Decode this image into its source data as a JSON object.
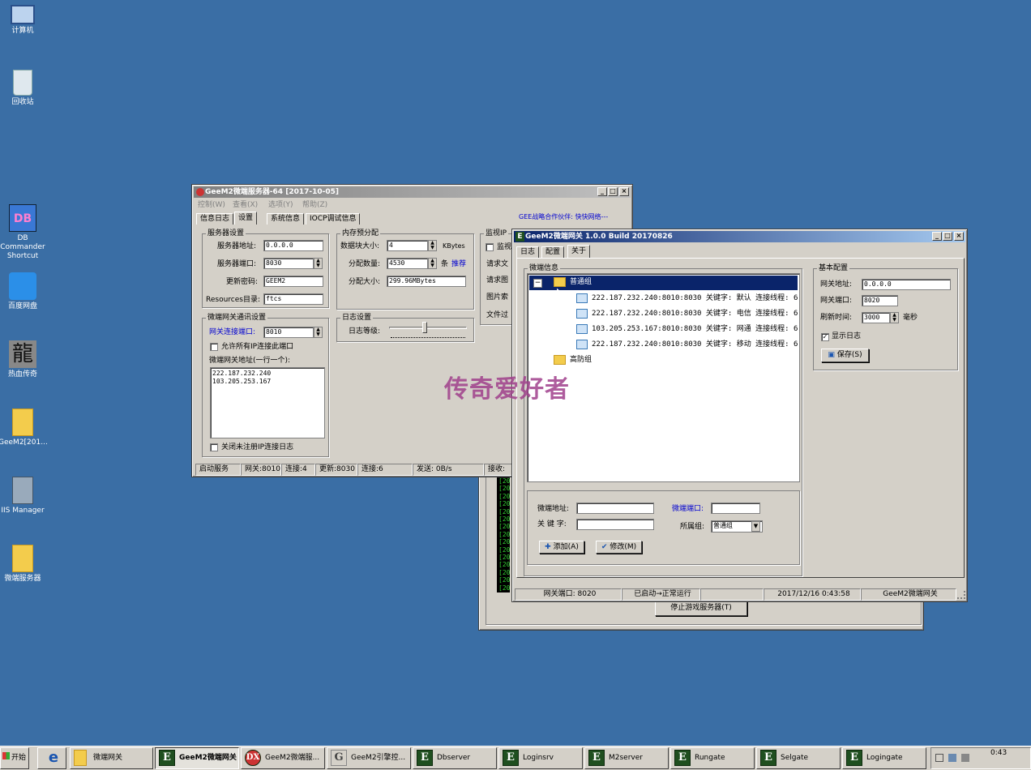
{
  "desktop": {
    "icons": [
      {
        "label": "计算机"
      },
      {
        "label": "回收站"
      },
      {
        "label": "DB Commander Shortcut",
        "img_text": "DB"
      },
      {
        "label": "百度网盘"
      },
      {
        "label": "热血传奇",
        "img_text": "龍"
      },
      {
        "label": "GeeM2[201..."
      },
      {
        "label": "IIS Manager"
      },
      {
        "label": "微端服务器"
      }
    ],
    "watermark": "传奇爱好者"
  },
  "server_window": {
    "title": "GeeM2微端服务器-64 [2017-10-05]",
    "menus": [
      "控制(W)",
      "查看(X)",
      "选项(Y)",
      "帮助(Z)"
    ],
    "partner_link": "GEE战略合作伙伴: 快快网络---",
    "tabs": [
      "信息日志",
      "设置",
      "系统信息",
      "IOCP调试信息"
    ],
    "server_settings": {
      "group": "服务器设置",
      "addr_label": "服务器地址:",
      "addr_value": "0.0.0.0",
      "port_label": "服务器端口:",
      "port_value": "8030",
      "pwd_label": "更新密码:",
      "pwd_value": "GEEM2",
      "res_label": "Resources目录:",
      "res_value": "ftcs"
    },
    "memory": {
      "group": "内存预分配",
      "block_label": "数据块大小:",
      "block_value": "4",
      "block_unit": "KBytes",
      "count_label": "分配数量:",
      "count_value": "4530",
      "count_unit": "条",
      "recommend": "推荐",
      "size_label": "分配大小:",
      "size_value": "299.96MBytes"
    },
    "monitor": {
      "group": "监视IP",
      "chk_label": "监视",
      "rows": [
        "请求文",
        "请求图",
        "图片索",
        "文件过"
      ]
    },
    "gateway": {
      "group": "微端网关通讯设置",
      "port_label": "网关连接端口:",
      "port_value": "8010",
      "allow_all_label": "允许所有IP连接此端口",
      "addr_list_label": "微端网关地址(一行一个):",
      "addresses": "222.187.232.240\n103.205.253.167",
      "close_log_label": "关闭未注册IP连接日志"
    },
    "log": {
      "group": "日志设置",
      "level_label": "日志等级:",
      "level_fraction": 0.45
    },
    "status": [
      "启动服务",
      "网关:8010",
      "连接:4",
      "更新:8030",
      "连接:6",
      "发送: 0B/s",
      "接收:"
    ]
  },
  "back_window": {
    "stop_button": "停止游戏服务器(T)",
    "log_lines": [
      "[20",
      "[20",
      "[20",
      "[20",
      "[20",
      "[20",
      "[20",
      "[20",
      "[20",
      "[20",
      "[20",
      "[20",
      "[20",
      "[20",
      "[20"
    ]
  },
  "gateway_window": {
    "title": "GeeM2微端网关 1.0.0 Build 20170826",
    "tabs": [
      "日志",
      "配置",
      "关于"
    ],
    "info_group": "微端信息",
    "tree": {
      "group1": "普通组",
      "nodes": [
        "222.187.232.240:8010:8030 关键字: 默认 连接线程: 6",
        "222.187.232.240:8010:8030 关键字: 电信 连接线程: 6",
        "103.205.253.167:8010:8030 关键字: 网通 连接线程: 6",
        "222.187.232.240:8010:8030 关键字: 移动 连接线程: 6"
      ],
      "group2": "高防组"
    },
    "form": {
      "addr_label": "微端地址:",
      "port_label": "微端端口:",
      "key_label": "关 键 字:",
      "group_label": "所属组:",
      "group_value": "普通组",
      "add_button": "添加(A)",
      "modify_button": "修改(M)"
    },
    "basic": {
      "group": "基本配置",
      "addr_label": "网关地址:",
      "addr_value": "0.0.0.0",
      "port_label": "网关端口:",
      "port_value": "8020",
      "refresh_label": "刷新时间:",
      "refresh_value": "3000",
      "refresh_unit": "毫秒",
      "show_log_label": "显示日志",
      "save_button": "保存(S)"
    },
    "status": [
      "网关端口: 8020",
      "已启动→正常运行",
      "",
      "2017/12/16 0:43:58",
      "GeeM2微端网关"
    ]
  },
  "taskbar": {
    "start": "开始",
    "tasks": [
      "微端网关",
      "GeeM2微端网关",
      "GeeM2微端服...",
      "GeeM2引擎控...",
      "Dbserver",
      "Loginsrv",
      "M2server",
      "Rungate",
      "Selgate",
      "Logingate"
    ],
    "clock": "0:43"
  }
}
